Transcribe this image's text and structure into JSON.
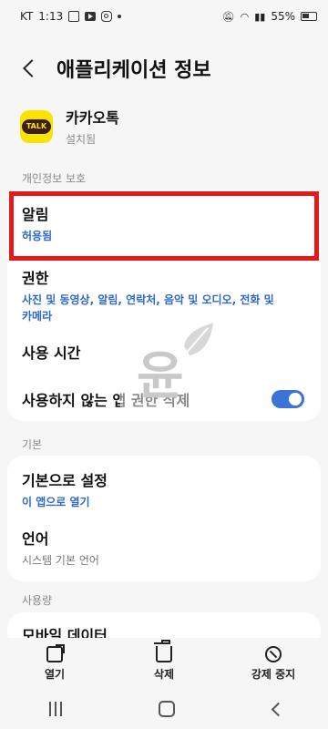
{
  "status_bar": {
    "carrier": "KT",
    "time": "1:13",
    "battery": "55%"
  },
  "header": {
    "title": "애플리케이션 정보"
  },
  "app": {
    "name": "카카오톡",
    "status": "설치됨",
    "icon_text": "TALK"
  },
  "sections": {
    "privacy": "개인정보 보호",
    "basic": "기본",
    "usage": "사용량"
  },
  "items": {
    "notifications": {
      "title": "알림",
      "sub": "허용됨"
    },
    "permissions": {
      "title": "권한",
      "sub": "사진 및 동영상, 알림, 연락처, 음악 및 오디오, 전화 및 카메라"
    },
    "screen_time": {
      "title": "사용 시간"
    },
    "remove_perm": {
      "title": "사용하지 않는 앱 권한 삭제",
      "toggle_on": true
    },
    "default": {
      "title": "기본으로 설정",
      "sub": "이 앱으로 열기"
    },
    "language": {
      "title": "언어",
      "sub": "시스템 기본 언어"
    },
    "mobile_data": {
      "title": "모바일 데이터"
    }
  },
  "bottom_actions": {
    "open": "열기",
    "delete": "삭제",
    "force_stop": "강제 중지"
  },
  "watermark": {
    "text": "윤"
  },
  "colors": {
    "accent": "#2f68c9",
    "highlight": "#e6181b",
    "toggle": "#3b74d6",
    "kakao": "#fbe300"
  }
}
